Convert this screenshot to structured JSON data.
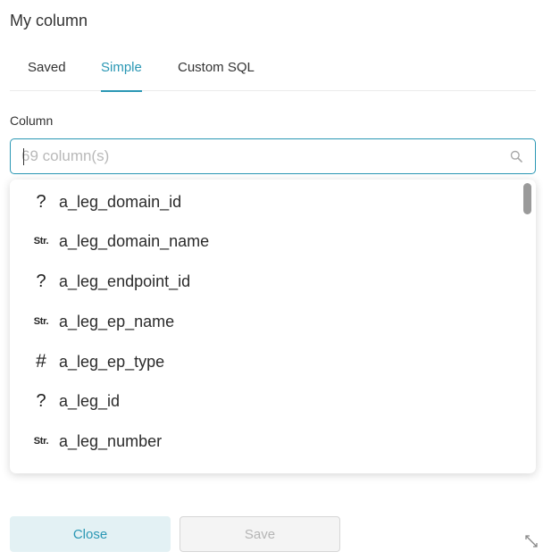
{
  "header": {
    "title": "My column"
  },
  "tabs": [
    {
      "label": "Saved",
      "active": false
    },
    {
      "label": "Simple",
      "active": true
    },
    {
      "label": "Custom SQL",
      "active": false
    }
  ],
  "column_field": {
    "label": "Column",
    "placeholder": "69 column(s)",
    "value": ""
  },
  "columns": [
    {
      "type": "unknown",
      "type_glyph": "?",
      "name": "a_leg_domain_id"
    },
    {
      "type": "string",
      "type_glyph": "Str.",
      "name": "a_leg_domain_name"
    },
    {
      "type": "unknown",
      "type_glyph": "?",
      "name": "a_leg_endpoint_id"
    },
    {
      "type": "string",
      "type_glyph": "Str.",
      "name": "a_leg_ep_name"
    },
    {
      "type": "number",
      "type_glyph": "#",
      "name": "a_leg_ep_type"
    },
    {
      "type": "unknown",
      "type_glyph": "?",
      "name": "a_leg_id"
    },
    {
      "type": "string",
      "type_glyph": "Str.",
      "name": "a_leg_number"
    }
  ],
  "footer": {
    "close_label": "Close",
    "save_label": "Save"
  },
  "colors": {
    "accent": "#2a97b4",
    "close_bg": "#e3f1f4",
    "disabled_text": "#b5b5b5"
  },
  "icons": {
    "search": "search-icon",
    "resize": "resize-icon"
  }
}
